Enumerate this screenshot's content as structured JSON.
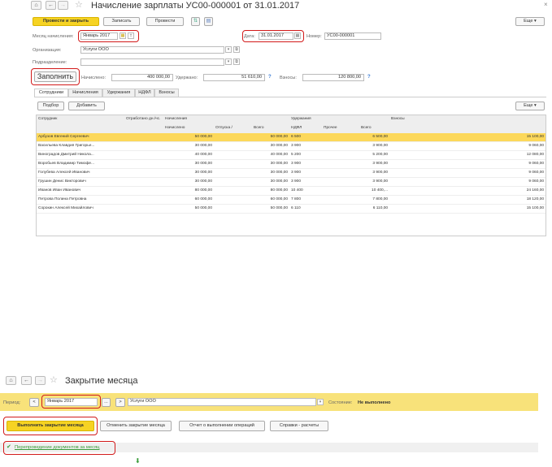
{
  "top": {
    "title": "Начисление зарплаты УС00-000001 от 31.01.2017",
    "close": "×",
    "nav_home": "⌂",
    "nav_back": "←",
    "nav_fwd": "→",
    "toolbar": {
      "post_close": "Провести и закрыть",
      "save": "Записать",
      "post": "Провести",
      "more": "Еще"
    },
    "month_label": "Месяц начисления:",
    "month_value": "Январь 2017",
    "date_label": "Дата:",
    "date_value": "31.01.2017",
    "number_label": "Номер:",
    "number_value": "УС00-000001",
    "org_label": "Организация:",
    "org_value": "Услуги ООО",
    "dept_label": "Подразделение:",
    "dept_value": "",
    "fill_button": "Заполнить",
    "accrued_label": "Начислено:",
    "accrued_value": "400 000,00",
    "withheld_label": "Удержано:",
    "withheld_value": "51 610,00",
    "contrib_label": "Взносы:",
    "contrib_value": "120 800,00",
    "help": "?",
    "tabs": [
      "Сотрудники",
      "Начисления",
      "Удержания",
      "НДФЛ",
      "Взносы"
    ],
    "sub_pick": "Подбор",
    "sub_add": "Добавить",
    "sub_more": "Еще",
    "table": {
      "h_emp": "Сотрудник",
      "h_worked": "Отработано дн./чс.",
      "h_accr": "Начисления",
      "h_with": "Удержания",
      "h_contrib": "Взносы",
      "h_accrued": "Начислено",
      "h_vac": "Отпуска /",
      "h_total": "Всего",
      "h_ndfl": "НДФЛ",
      "h_other": "Прочее",
      "h_total2": "Всего",
      "rows": [
        {
          "name": "Арбузов Евгений Сергеевич",
          "accrued": "50 000,00",
          "total": "50 000,00",
          "ndfl": "6 500",
          "total2": "6 500,00",
          "contrib": "15 100,00"
        },
        {
          "name": "Васильева Клавдия Григорье...",
          "accrued": "30 000,00",
          "total": "30 000,00",
          "ndfl": "3 900",
          "total2": "3 900,00",
          "contrib": "9 060,00"
        },
        {
          "name": "Виноградов Дмитрий Никола...",
          "accrued": "40 000,00",
          "total": "40 000,00",
          "ndfl": "5 200",
          "total2": "5 200,00",
          "contrib": "12 080,00"
        },
        {
          "name": "Воробьев Владимир Тимофе...",
          "accrued": "30 000,00",
          "total": "30 000,00",
          "ndfl": "3 900",
          "total2": "3 900,00",
          "contrib": "9 060,00"
        },
        {
          "name": "Голубева Алексей Иванович",
          "accrued": "30 000,00",
          "total": "30 000,00",
          "ndfl": "3 900",
          "total2": "3 900,00",
          "contrib": "9 060,00"
        },
        {
          "name": "Грушин Денис Викторович",
          "accrued": "30 000,00",
          "total": "30 000,00",
          "ndfl": "3 900",
          "total2": "3 900,00",
          "contrib": "9 060,00"
        },
        {
          "name": "Иванов Иван Иванович",
          "accrued": "80 000,00",
          "total": "80 000,00",
          "ndfl": "10 400",
          "total2": "10 400,...",
          "contrib": "24 160,00"
        },
        {
          "name": "Петрова Полина Петровна",
          "accrued": "60 000,00",
          "total": "60 000,00",
          "ndfl": "7 800",
          "total2": "7 800,00",
          "contrib": "18 120,00"
        },
        {
          "name": "Сорокин Алексей Михайлович",
          "accrued": "50 000,00",
          "total": "50 000,00",
          "ndfl": "6 110",
          "total2": "6 110,00",
          "contrib": "15 100,00"
        }
      ]
    }
  },
  "bottom": {
    "title": "Закрытие месяца",
    "period_label": "Период:",
    "prev": "<",
    "next": ">",
    "period_value": "Январь 2017",
    "ellipsis": "...",
    "org_value": "Услуги ООО",
    "state_label": "Состояние:",
    "state_value": "Не выполнено",
    "btn_run": "Выполнить закрытие месяца",
    "btn_cancel": "Отменить закрытие месяца",
    "btn_report": "Отчет о выполнении операций",
    "btn_refs": "Справки - расчеты",
    "step_check": "✔",
    "step_label": "Перепроведение документов за месяц",
    "arrow": "⬇"
  }
}
